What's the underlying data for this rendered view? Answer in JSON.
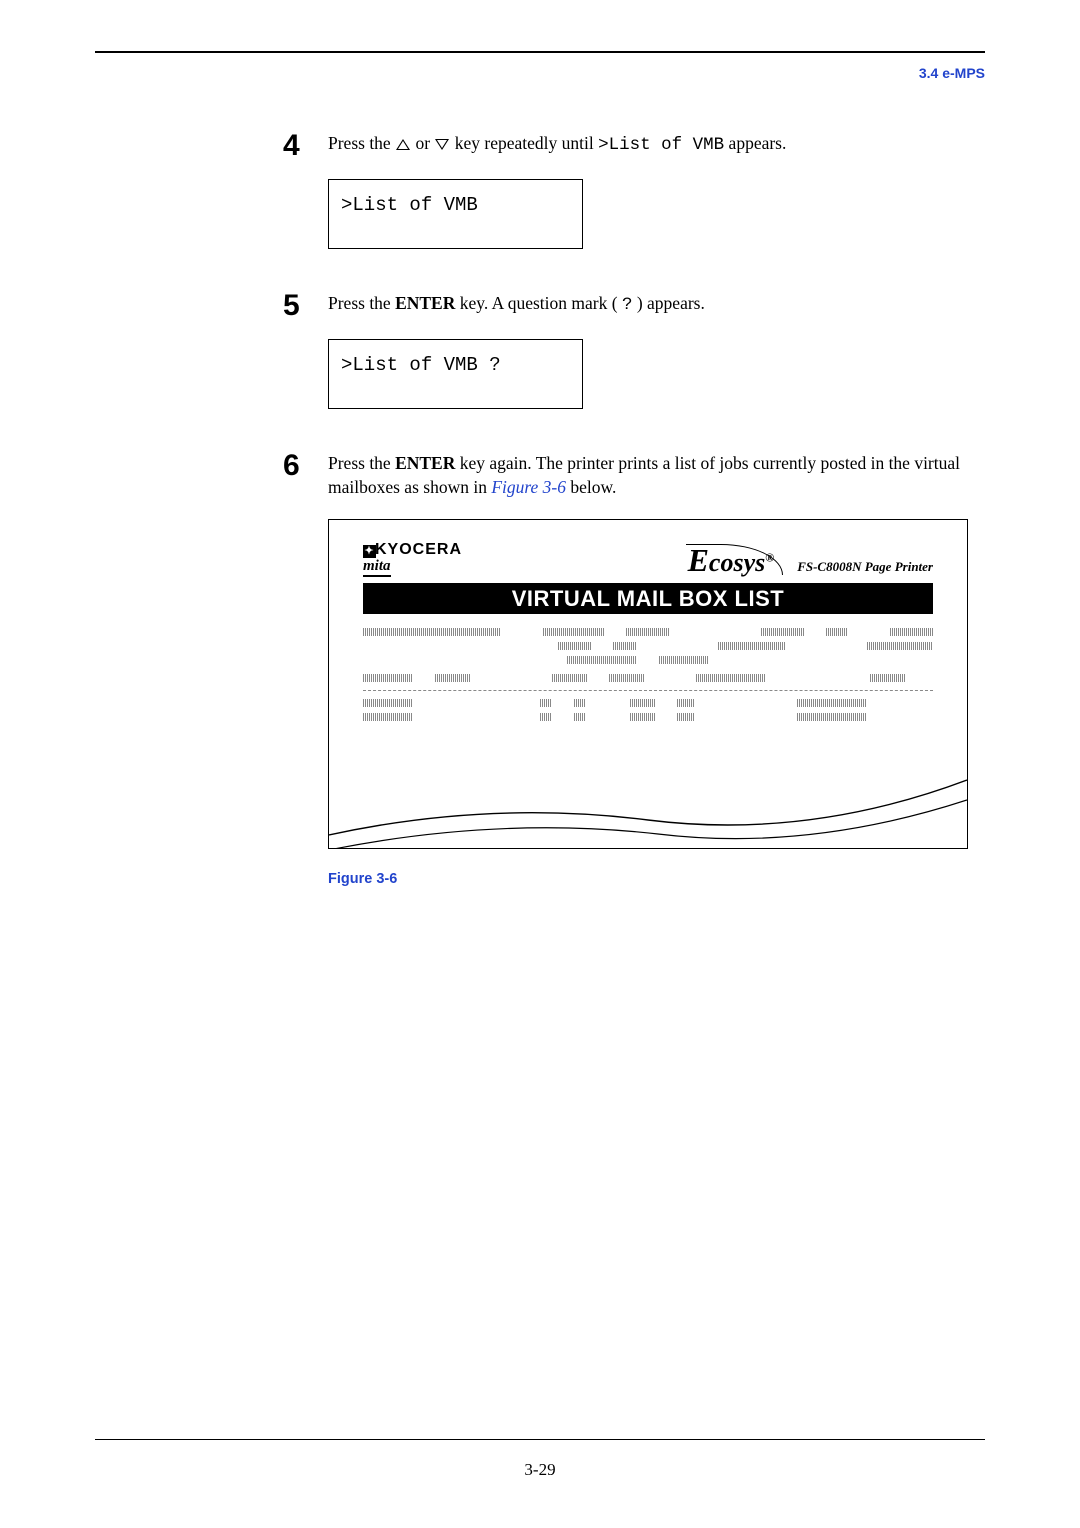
{
  "header": {
    "section_ref": "3.4 e-MPS"
  },
  "steps": {
    "s4": {
      "number": "4",
      "text_pre": "Press the ",
      "text_mid": " or ",
      "text_post1": " key repeatedly until ",
      "mono1": ">List of VMB",
      "text_post2": " appears."
    },
    "s5": {
      "number": "5",
      "text_pre": "Press the ",
      "key_name": "ENTER",
      "text_mid": " key. A question mark (",
      "mono1": "?",
      "text_post": ") appears."
    },
    "s6": {
      "number": "6",
      "text_pre": "Press the ",
      "key_name": "ENTER",
      "text_mid": " key again. The printer prints a list of jobs currently posted in the virtual mailboxes as shown in ",
      "fig_ref": "Figure 3-6",
      "text_post": " below."
    }
  },
  "lcd": {
    "screen1": ">List of VMB",
    "screen2": ">List of VMB ?"
  },
  "printout": {
    "brand_top": "KYOCERA",
    "brand_sub": "mita",
    "ecosys": "Ecosys",
    "model": "FS-C8008N  Page Printer",
    "title": "VIRTUAL MAIL BOX LIST"
  },
  "figure": {
    "caption": "Figure 3-6"
  },
  "footer": {
    "page_no": "3-29"
  }
}
